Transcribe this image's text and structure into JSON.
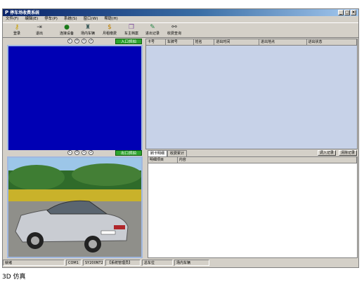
{
  "window": {
    "title": "停车场收费系统",
    "app_icon": "parking-app-icon"
  },
  "menu": [
    "文件(F)",
    "编辑(E)",
    "停车(P)",
    "系统(S)",
    "窗口(W)",
    "帮助(H)"
  ],
  "toolbar": [
    {
      "label": "登录",
      "icon": "key-icon"
    },
    {
      "label": "退出",
      "icon": "exit-icon"
    },
    {
      "label": "连接设备",
      "icon": "device-icon"
    },
    {
      "label": "场内车辆",
      "icon": "car-inside-icon"
    },
    {
      "label": "月租缴费",
      "icon": "money-icon"
    },
    {
      "label": "车主档案",
      "icon": "files-icon"
    },
    {
      "label": "进出记录",
      "icon": "record-icon"
    },
    {
      "label": "收费查询",
      "icon": "binoculars-icon"
    }
  ],
  "entry_panel": {
    "buttons": [
      "C",
      "0",
      "1",
      "2"
    ],
    "action": "入口抓拍"
  },
  "exit_panel": {
    "buttons": [
      "C",
      "0",
      "1",
      "2"
    ],
    "action": "出口抓拍"
  },
  "top_table": {
    "columns": [
      "卡号",
      "车牌号",
      "姓名",
      "进出时间",
      "进出地点",
      "进出状态"
    ]
  },
  "bottom_tabs": {
    "tabs": [
      "刷卡明细",
      "收费累计"
    ],
    "buttons": [
      "调入记录",
      "清除记录"
    ]
  },
  "detail_table": {
    "columns": [
      "明细项目",
      "内容"
    ]
  },
  "status": [
    "就绪",
    "",
    "COM1",
    "SY200NT2",
    "【系统管理员】",
    "总车位",
    "场内车辆"
  ],
  "caption": "3D 仿真",
  "colors": {
    "video_bg": "#0000b4",
    "table_bg": "#c7d2e8",
    "green_button": "#2fa52f"
  }
}
